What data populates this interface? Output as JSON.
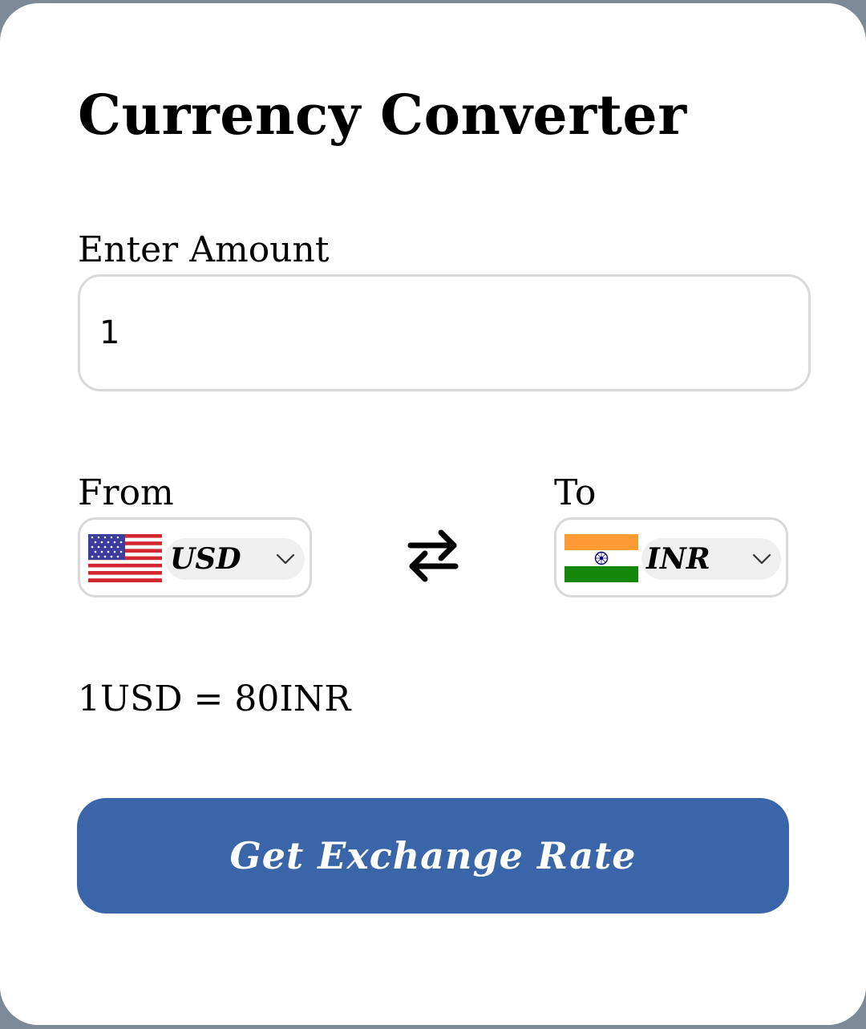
{
  "title": "Currency Converter",
  "amount": {
    "label": "Enter Amount",
    "value": "1"
  },
  "from": {
    "label": "From",
    "code": "USD",
    "flag_icon": "us-flag-icon"
  },
  "to": {
    "label": "To",
    "code": "INR",
    "flag_icon": "india-flag-icon"
  },
  "swap_icon": "swap-arrows-icon",
  "rate_text": "1USD = 80INR",
  "button_label": "Get Exchange Rate",
  "colors": {
    "accent": "#3a65a8",
    "background": "#7b8a96",
    "card": "#ffffff",
    "border": "#d9d9d9"
  }
}
